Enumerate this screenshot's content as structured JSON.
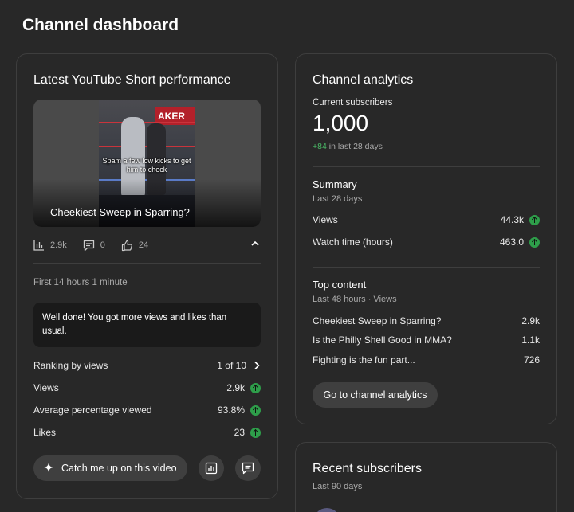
{
  "page": {
    "title": "Channel dashboard"
  },
  "short_card": {
    "title": "Latest YouTube Short performance",
    "video_title": "Cheekiest Sweep in Sparring?",
    "thumb_caption": "Spam a few low kicks to get him to check",
    "thumb_sign": "AKER",
    "stats": {
      "views": "2.9k",
      "comments": "0",
      "likes": "24"
    },
    "period": "First 14 hours 1 minute",
    "notice": "Well done! You got more views and likes than usual.",
    "rows": [
      {
        "label": "Ranking by views",
        "value": "1 of 10"
      },
      {
        "label": "Views",
        "value": "2.9k"
      },
      {
        "label": "Average percentage viewed",
        "value": "93.8%"
      },
      {
        "label": "Likes",
        "value": "23"
      }
    ],
    "catch_up_label": "Catch me up on this video"
  },
  "analytics_card": {
    "title": "Channel analytics",
    "subs_label": "Current subscribers",
    "subs_value": "1,000",
    "subs_delta": "+84",
    "subs_delta_suffix": " in last 28 days",
    "summary": {
      "title": "Summary",
      "period": "Last 28 days",
      "rows": [
        {
          "label": "Views",
          "value": "44.3k"
        },
        {
          "label": "Watch time (hours)",
          "value": "463.0"
        }
      ]
    },
    "top_content": {
      "title": "Top content",
      "period": "Last 48 hours · Views",
      "rows": [
        {
          "label": "Cheekiest Sweep in Sparring?",
          "value": "2.9k"
        },
        {
          "label": "Is the Philly Shell Good in MMA?",
          "value": "1.1k"
        },
        {
          "label": "Fighting is the fun part...",
          "value": "726"
        }
      ]
    },
    "button_label": "Go to channel analytics"
  },
  "subscribers_card": {
    "title": "Recent subscribers",
    "period": "Last 90 days"
  },
  "colors": {
    "background": "#282828",
    "trend_up": "#2e9e4a",
    "card_border": "#3e3e3e"
  }
}
